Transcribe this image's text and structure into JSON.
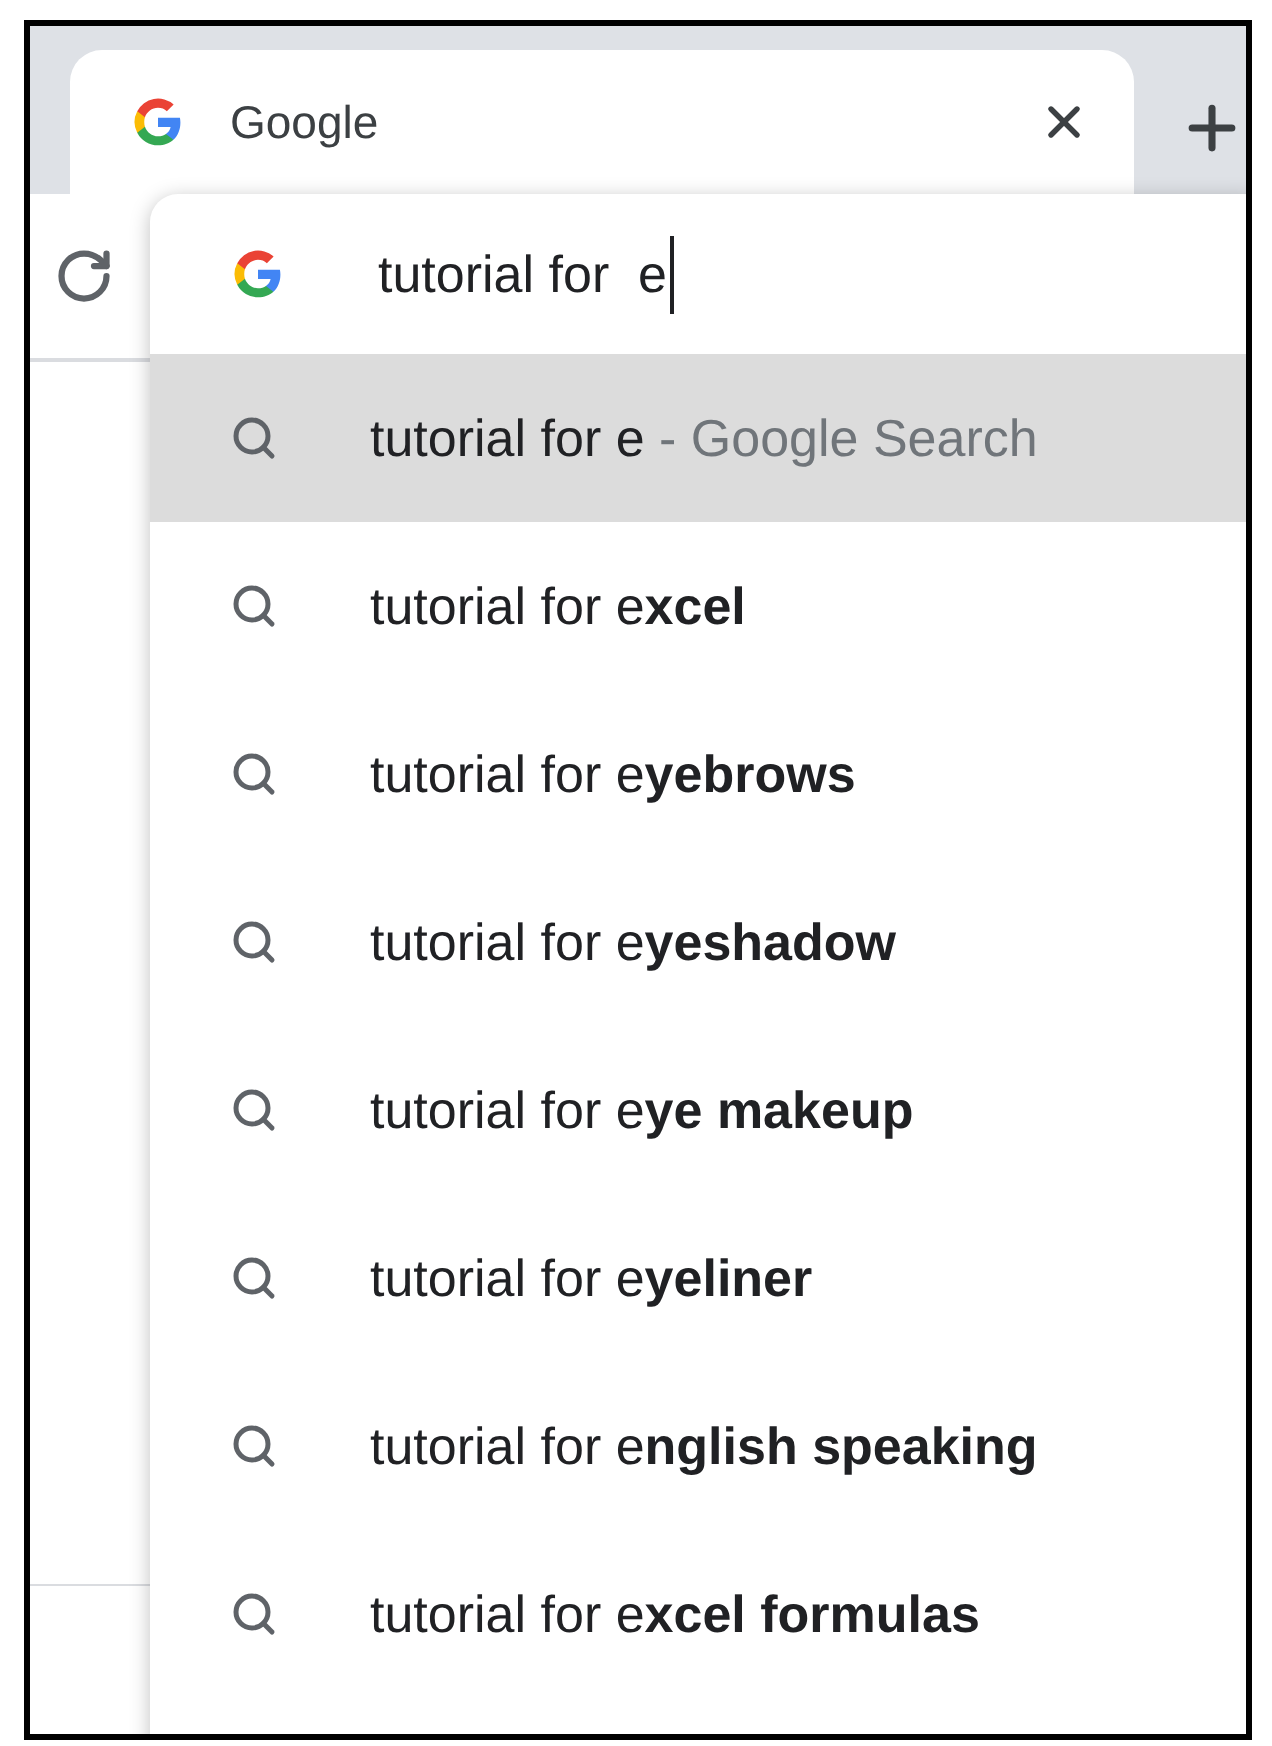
{
  "tab": {
    "title": "Google"
  },
  "omnibox": {
    "value": "tutorial for  e"
  },
  "suggestions": [
    {
      "text": "tutorial for e",
      "suffix": "- Google Search",
      "selected": true
    },
    {
      "text": "tutorial for e**xcel**",
      "selected": false
    },
    {
      "text": "tutorial for e**yebrows**",
      "selected": false
    },
    {
      "text": "tutorial for e**yeshadow**",
      "selected": false
    },
    {
      "text": "tutorial for e**ye makeup**",
      "selected": false
    },
    {
      "text": "tutorial for e**yeliner**",
      "selected": false
    },
    {
      "text": "tutorial for e**nglish speaking**",
      "selected": false
    },
    {
      "text": "tutorial for e**xcel formulas**",
      "selected": false
    }
  ]
}
